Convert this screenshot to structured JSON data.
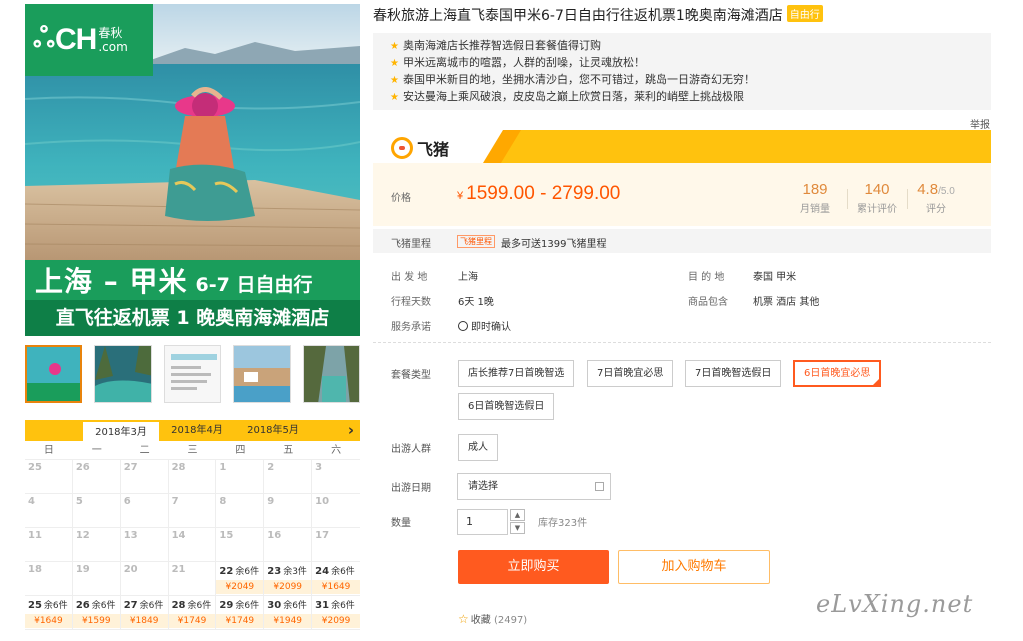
{
  "hero": {
    "logo_mark": "ஃ",
    "logo_text": "CH",
    "logo_cn": "春秋",
    "logo_com": ".com",
    "banner_big": "上海 – 甲米",
    "banner_small": "6-7 日自由行",
    "banner_line2": "直飞往返机票 1 晚奥南海滩酒店"
  },
  "calendar": {
    "tabs": [
      "2018年3月",
      "2018年4月",
      "2018年5月"
    ],
    "next": "›",
    "weekdays": [
      "日",
      "一",
      "二",
      "三",
      "四",
      "五",
      "六"
    ],
    "cells": [
      {
        "d": "25"
      },
      {
        "d": "26"
      },
      {
        "d": "27"
      },
      {
        "d": "28"
      },
      {
        "d": "1"
      },
      {
        "d": "2"
      },
      {
        "d": "3"
      },
      {
        "d": "4"
      },
      {
        "d": "5"
      },
      {
        "d": "6"
      },
      {
        "d": "7"
      },
      {
        "d": "8"
      },
      {
        "d": "9"
      },
      {
        "d": "10"
      },
      {
        "d": "11"
      },
      {
        "d": "12"
      },
      {
        "d": "13"
      },
      {
        "d": "14"
      },
      {
        "d": "15"
      },
      {
        "d": "16"
      },
      {
        "d": "17"
      },
      {
        "d": "18"
      },
      {
        "d": "19"
      },
      {
        "d": "20"
      },
      {
        "d": "21"
      },
      {
        "d": "22",
        "rem": "余6件",
        "price": "¥2049"
      },
      {
        "d": "23",
        "rem": "余3件",
        "price": "¥2099"
      },
      {
        "d": "24",
        "rem": "余6件",
        "price": "¥1649"
      },
      {
        "d": "25",
        "rem": "余6件",
        "price": "¥1649"
      },
      {
        "d": "26",
        "rem": "余6件",
        "price": "¥1599"
      },
      {
        "d": "27",
        "rem": "余6件",
        "price": "¥1849"
      },
      {
        "d": "28",
        "rem": "余6件",
        "price": "¥1749"
      },
      {
        "d": "29",
        "rem": "余6件",
        "price": "¥1749"
      },
      {
        "d": "30",
        "rem": "余6件",
        "price": "¥1949"
      },
      {
        "d": "31",
        "rem": "余6件",
        "price": "¥2099"
      }
    ]
  },
  "product": {
    "title": "春秋旅游上海直飞泰国甲米6-7日自由行往返机票1晚奥南海滩酒店",
    "badge": "自由行",
    "highlights": [
      "奥南海滩店长推荐智选假日套餐值得订购",
      "甲米远离城市的喧嚣，人群的刮噪，让灵魂放松！",
      "泰国甲米新目的地，坐拥水清沙白，您不可错过，跳岛一日游奇幻无穷！",
      "安达曼海上乘风破浪，皮皮岛之巅上欣赏日落，莱利的峭壁上挑战极限"
    ],
    "report": "举报"
  },
  "fliggy": {
    "logo": "飞猪"
  },
  "price": {
    "label": "价格",
    "currency": "¥",
    "range": "1599.00 - 2799.00",
    "monthly_sales": "189",
    "monthly_sales_label": "月销量",
    "reviews": "140",
    "reviews_label": "累计评价",
    "rating": "4.8",
    "rating_max": "/5.0",
    "rating_label": "评分"
  },
  "miles": {
    "label": "飞猪里程",
    "tag": "飞猪里程",
    "text": "最多可送1399飞猪里程"
  },
  "details": {
    "depart_label": "出 发 地",
    "depart": "上海",
    "dest_label": "目 的 地",
    "dest": "泰国  甲米",
    "days_label": "行程天数",
    "days": "6天  1晚",
    "includes_label": "商品包含",
    "includes": "机票  酒店  其他",
    "service_label": "服务承诺",
    "service": "即时确认"
  },
  "options": {
    "package_label": "套餐类型",
    "packages": [
      "店长推荐7日首晚智选",
      "7日首晚宜必思",
      "7日首晚智选假日",
      "6日首晚宜必思",
      "6日首晚智选假日"
    ],
    "selected": "6日首晚宜必思",
    "crowd_label": "出游人群",
    "crowd": "成人",
    "date_label": "出游日期",
    "date_placeholder": "请选择",
    "qty_label": "数量",
    "qty": "1",
    "stock": "库存323件"
  },
  "actions": {
    "buy": "立即购买",
    "cart": "加入购物车",
    "fav": "收藏",
    "fav_count": "(2497)"
  },
  "watermark": "eLvXing.net",
  "colors": {
    "accent": "#ff5a1f",
    "fliggy_yellow": "#ffc20e",
    "brand_green": "#1a9d5b",
    "price": "#ff5500"
  }
}
